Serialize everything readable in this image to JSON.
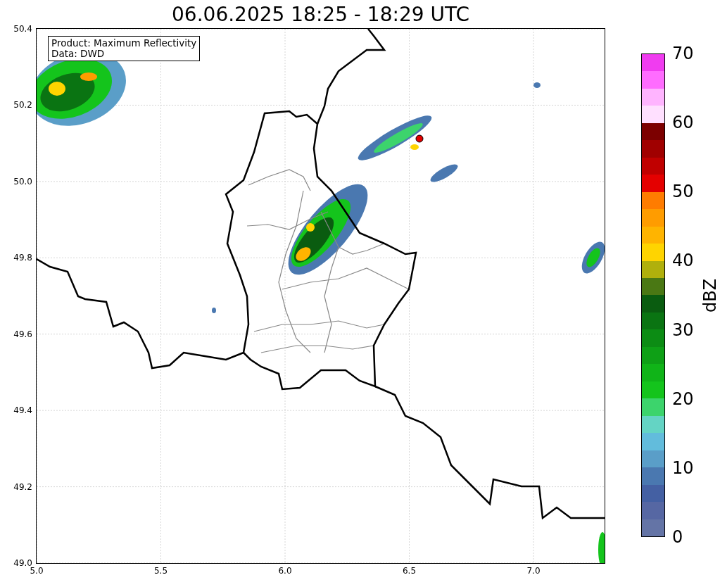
{
  "title": "06.06.2025 18:25 - 18:29 UTC",
  "map": {
    "legend": [
      "Product: Maximum Reflectivity",
      "Data: DWD"
    ],
    "xticks": [
      "5.0",
      "5.5",
      "6.0",
      "6.5",
      "7.0"
    ],
    "yticks": [
      "50.4",
      "50.2",
      "50.0",
      "49.8",
      "49.6",
      "49.4",
      "49.2",
      "49.0"
    ]
  },
  "colorbar": {
    "label": "dBZ",
    "ticks": [
      "70",
      "60",
      "50",
      "40",
      "30",
      "20",
      "10",
      "0"
    ],
    "steps": [
      {
        "color": "#6474a6"
      },
      {
        "color": "#5667a3"
      },
      {
        "color": "#4460a3"
      },
      {
        "color": "#4a78b0"
      },
      {
        "color": "#5a9ec8"
      },
      {
        "color": "#62bcdc"
      },
      {
        "color": "#64d4c4"
      },
      {
        "color": "#3cd46c"
      },
      {
        "color": "#14c41c"
      },
      {
        "color": "#10b418"
      },
      {
        "color": "#0ea016"
      },
      {
        "color": "#0c8c14"
      },
      {
        "color": "#0a7412"
      },
      {
        "color": "#0a5c10"
      },
      {
        "color": "#4a7814"
      },
      {
        "color": "#b0b00c"
      },
      {
        "color": "#ffd400"
      },
      {
        "color": "#ffb400"
      },
      {
        "color": "#ff9c00"
      },
      {
        "color": "#ff7c00"
      },
      {
        "color": "#e40000"
      },
      {
        "color": "#c00000"
      },
      {
        "color": "#a00000"
      },
      {
        "color": "#7c0000"
      },
      {
        "color": "#ffe0ff"
      },
      {
        "color": "#ffb4ff"
      },
      {
        "color": "#ff6cff"
      },
      {
        "color": "#f03cf0"
      }
    ]
  }
}
